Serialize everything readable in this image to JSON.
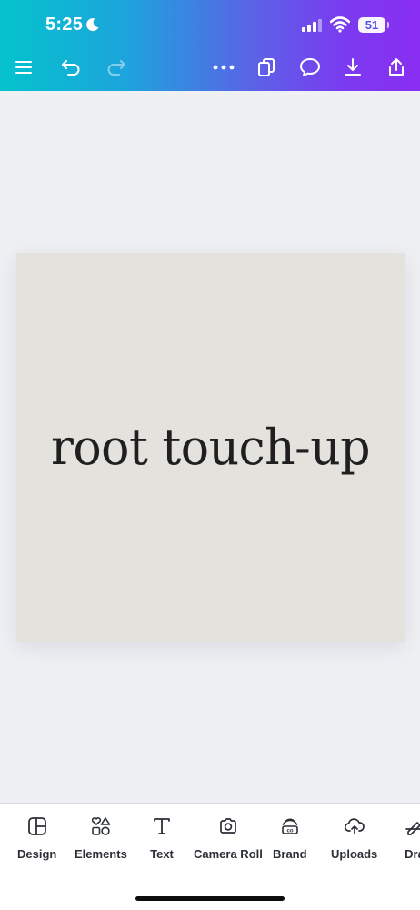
{
  "status_bar": {
    "time": "5:25",
    "battery": "51"
  },
  "toolbar": {
    "icons": [
      "menu-icon",
      "undo-icon",
      "redo-icon",
      "more-icon",
      "pages-icon",
      "comment-icon",
      "download-icon",
      "share-icon"
    ]
  },
  "canvas": {
    "text": "root touch-up",
    "background_color": "#e4e2dd"
  },
  "bottom_nav": {
    "items": [
      {
        "label": "Design",
        "icon": "design-icon"
      },
      {
        "label": "Elements",
        "icon": "elements-icon"
      },
      {
        "label": "Text",
        "icon": "text-icon"
      },
      {
        "label": "Camera Roll",
        "icon": "camera-icon"
      },
      {
        "label": "Brand",
        "icon": "brand-icon"
      },
      {
        "label": "Uploads",
        "icon": "uploads-icon"
      },
      {
        "label": "Dra",
        "icon": "draw-icon"
      }
    ]
  },
  "colors": {
    "gradient_start": "#05c3cc",
    "gradient_end": "#8a2ef2"
  }
}
